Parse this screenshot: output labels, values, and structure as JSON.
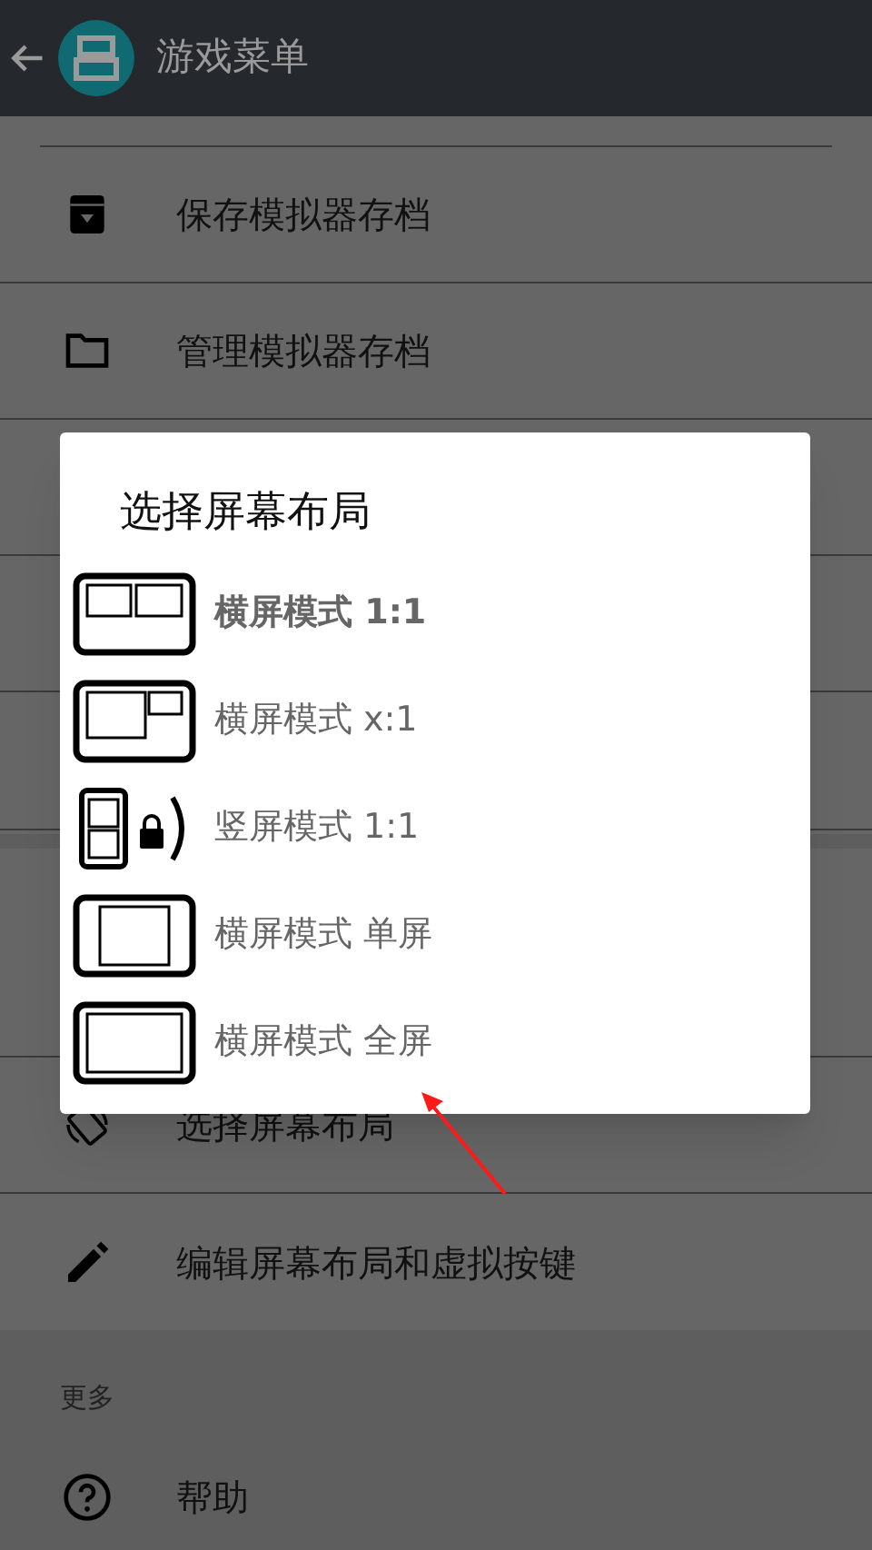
{
  "app_bar": {
    "title": "游戏菜单"
  },
  "menu_top": [
    {
      "kind": "save",
      "label": "保存模拟器存档"
    },
    {
      "kind": "folder",
      "label": "管理模拟器存档"
    },
    {
      "kind": "hidden"
    },
    {
      "kind": "hidden"
    },
    {
      "kind": "hidden"
    }
  ],
  "menu_bottom": [
    {
      "kind": "hidden"
    },
    {
      "kind": "rotate",
      "label": "选择屏幕布局"
    },
    {
      "kind": "pencil",
      "label": "编辑屏幕布局和虚拟按键"
    }
  ],
  "more_section": {
    "heading": "更多",
    "items": [
      {
        "kind": "help",
        "label": "帮助"
      }
    ]
  },
  "dialog": {
    "title": "选择屏幕布局",
    "options": [
      {
        "kind": "split",
        "label": "横屏模式 1:1",
        "selected": true
      },
      {
        "kind": "large_small",
        "label": "横屏模式 x:1",
        "selected": false
      },
      {
        "kind": "portrait",
        "label": "竖屏模式 1:1",
        "selected": false
      },
      {
        "kind": "single",
        "label": "横屏模式 单屏",
        "selected": false
      },
      {
        "kind": "full",
        "label": "横屏模式 全屏",
        "selected": false
      }
    ]
  }
}
